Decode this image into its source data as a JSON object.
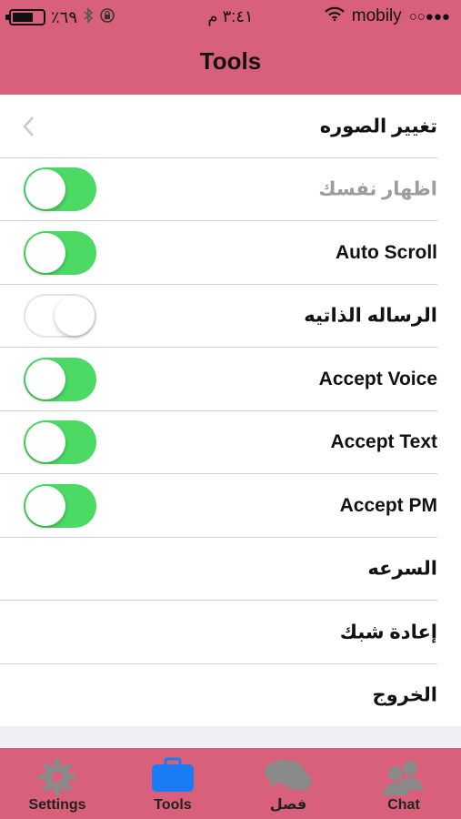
{
  "colors": {
    "bar_pink": "#d9607a",
    "toggle_on": "#4cd964",
    "active_tab": "#1a7cf5",
    "inactive_tab_icon": "#8a8a8a"
  },
  "status_bar": {
    "battery_percent": "٪٦٩",
    "time": "٣:٤١ م",
    "carrier": "mobily",
    "signal_dots": "○○●●●"
  },
  "nav": {
    "title": "Tools"
  },
  "rows": [
    {
      "label": "تغيير الصوره"
    },
    {
      "label": "اظهار نفسك",
      "toggle": true
    },
    {
      "label": "Auto Scroll",
      "toggle": true
    },
    {
      "label": "الرساله الذاتيه",
      "toggle": false
    },
    {
      "label": "Accept Voice",
      "toggle": true
    },
    {
      "label": "Accept Text",
      "toggle": true
    },
    {
      "label": "Accept PM",
      "toggle": true
    },
    {
      "label": "السرعه"
    },
    {
      "label": "إعادة شبك"
    },
    {
      "label": "الخروج"
    }
  ],
  "tabs": [
    {
      "label": "Settings",
      "icon": "gear-icon"
    },
    {
      "label": "Tools",
      "icon": "toolbox-icon",
      "active": true
    },
    {
      "label": "فصل",
      "icon": "speech-bubbles-icon"
    },
    {
      "label": "Chat",
      "icon": "users-icon"
    }
  ]
}
